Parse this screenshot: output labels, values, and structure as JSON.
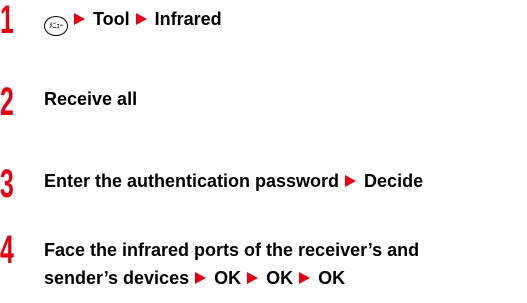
{
  "steps": [
    {
      "number": "1",
      "menu_key_label": "ﾒﾆｭｰ",
      "items": [
        "Tool",
        "Infrared"
      ]
    },
    {
      "number": "2",
      "text": "Receive all"
    },
    {
      "number": "3",
      "text": "Enter the authentication password",
      "items": [
        "Decide"
      ]
    },
    {
      "number": "4",
      "line1": "Face the infrared ports of the receiver’s and",
      "line2": "sender’s devices",
      "items": [
        "OK",
        "OK",
        "OK"
      ]
    }
  ],
  "colors": {
    "step_number": "#e50012",
    "arrow": "#e50012",
    "text": "#000000"
  },
  "icons": {
    "menu_key": "menu-key-icon",
    "arrow": "right-triangle-arrow-icon"
  }
}
